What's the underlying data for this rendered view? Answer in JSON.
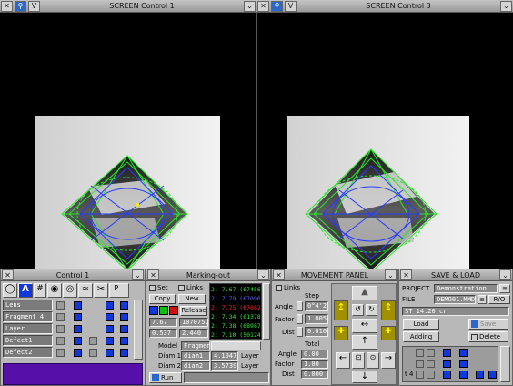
{
  "screens": {
    "left_title": "SCREEN Control 1",
    "right_title": "SCREEN Control 3",
    "menu_glyph": "V",
    "collapse_glyph": "⌄",
    "close_glyph": "✕"
  },
  "control1": {
    "title": "Control 1",
    "tool_labels": [
      "#",
      "P..."
    ],
    "rows": [
      "Lens",
      "Fragment 4",
      "Layer",
      "Defect1",
      "Defect2"
    ]
  },
  "markout": {
    "title": "Marking-out",
    "set": "Set",
    "links": "Links",
    "copy": "Copy",
    "new": "New",
    "release": "Release",
    "val1a": "7.67",
    "val1b": "107075.7",
    "val2a": "0.537",
    "val2b": "2.440",
    "list": [
      {
        "text": "2: 7.67 (67456",
        "color": "#34e834"
      },
      {
        "text": "2: 7.79 (67090",
        "color": "#6060ff"
      },
      {
        "text": "2: 7.75 (67082",
        "color": "#ff2828"
      },
      {
        "text": "2: 7.34 (61378",
        "color": "#34e834"
      },
      {
        "text": "2: 7.38 (68987",
        "color": "#34e834"
      },
      {
        "text": "2: 7.10 (50124",
        "color": "#34e834"
      }
    ],
    "model_label": "Model",
    "model_value": "Fragment",
    "diam1_label": "Diam 1",
    "diam1_name": "diam1",
    "diam1_value": "4.1047",
    "diam2_label": "Diam 2",
    "diam2_name": "diam2",
    "diam2_value": "3.5739",
    "layer": "Layer",
    "run": "Run"
  },
  "movement": {
    "title": "MOVEMENT PANEL",
    "links": "Links",
    "step": "Step",
    "angle_label": "Angle",
    "angle_value": "0°4'21",
    "factor_label": "Factor",
    "factor_value": "1.005",
    "dist_label": "Dist",
    "dist_value": "0.010",
    "total": "Total",
    "t_angle_value": "0.00",
    "t_factor_value": "1.00",
    "t_dist_value": "0.000"
  },
  "saveload": {
    "title": "SAVE & LOAD",
    "project_label": "PROJECT",
    "project_value": "Demonstration",
    "file_label": "FILE",
    "file_value": "DEMO01.MMD",
    "ro": "R/O",
    "stone": "ST 14.20 cr",
    "load": "Load",
    "save": "Save",
    "adding": "Adding",
    "delete": "Delete",
    "row_label": "t 4"
  },
  "colors": {
    "green_outline": "#28e628",
    "blue_outline": "#2a3cff",
    "purple_area": "#5410a8",
    "cursor_yellow": "#f0f000"
  }
}
